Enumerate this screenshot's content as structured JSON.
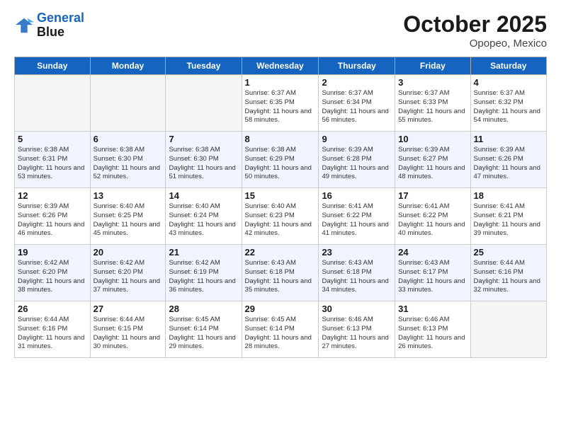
{
  "header": {
    "logo_line1": "General",
    "logo_line2": "Blue",
    "month": "October 2025",
    "location": "Opopeo, Mexico"
  },
  "weekdays": [
    "Sunday",
    "Monday",
    "Tuesday",
    "Wednesday",
    "Thursday",
    "Friday",
    "Saturday"
  ],
  "weeks": [
    [
      {
        "day": "",
        "info": ""
      },
      {
        "day": "",
        "info": ""
      },
      {
        "day": "",
        "info": ""
      },
      {
        "day": "1",
        "info": "Sunrise: 6:37 AM\nSunset: 6:35 PM\nDaylight: 11 hours\nand 58 minutes."
      },
      {
        "day": "2",
        "info": "Sunrise: 6:37 AM\nSunset: 6:34 PM\nDaylight: 11 hours\nand 56 minutes."
      },
      {
        "day": "3",
        "info": "Sunrise: 6:37 AM\nSunset: 6:33 PM\nDaylight: 11 hours\nand 55 minutes."
      },
      {
        "day": "4",
        "info": "Sunrise: 6:37 AM\nSunset: 6:32 PM\nDaylight: 11 hours\nand 54 minutes."
      }
    ],
    [
      {
        "day": "5",
        "info": "Sunrise: 6:38 AM\nSunset: 6:31 PM\nDaylight: 11 hours\nand 53 minutes."
      },
      {
        "day": "6",
        "info": "Sunrise: 6:38 AM\nSunset: 6:30 PM\nDaylight: 11 hours\nand 52 minutes."
      },
      {
        "day": "7",
        "info": "Sunrise: 6:38 AM\nSunset: 6:30 PM\nDaylight: 11 hours\nand 51 minutes."
      },
      {
        "day": "8",
        "info": "Sunrise: 6:38 AM\nSunset: 6:29 PM\nDaylight: 11 hours\nand 50 minutes."
      },
      {
        "day": "9",
        "info": "Sunrise: 6:39 AM\nSunset: 6:28 PM\nDaylight: 11 hours\nand 49 minutes."
      },
      {
        "day": "10",
        "info": "Sunrise: 6:39 AM\nSunset: 6:27 PM\nDaylight: 11 hours\nand 48 minutes."
      },
      {
        "day": "11",
        "info": "Sunrise: 6:39 AM\nSunset: 6:26 PM\nDaylight: 11 hours\nand 47 minutes."
      }
    ],
    [
      {
        "day": "12",
        "info": "Sunrise: 6:39 AM\nSunset: 6:26 PM\nDaylight: 11 hours\nand 46 minutes."
      },
      {
        "day": "13",
        "info": "Sunrise: 6:40 AM\nSunset: 6:25 PM\nDaylight: 11 hours\nand 45 minutes."
      },
      {
        "day": "14",
        "info": "Sunrise: 6:40 AM\nSunset: 6:24 PM\nDaylight: 11 hours\nand 43 minutes."
      },
      {
        "day": "15",
        "info": "Sunrise: 6:40 AM\nSunset: 6:23 PM\nDaylight: 11 hours\nand 42 minutes."
      },
      {
        "day": "16",
        "info": "Sunrise: 6:41 AM\nSunset: 6:22 PM\nDaylight: 11 hours\nand 41 minutes."
      },
      {
        "day": "17",
        "info": "Sunrise: 6:41 AM\nSunset: 6:22 PM\nDaylight: 11 hours\nand 40 minutes."
      },
      {
        "day": "18",
        "info": "Sunrise: 6:41 AM\nSunset: 6:21 PM\nDaylight: 11 hours\nand 39 minutes."
      }
    ],
    [
      {
        "day": "19",
        "info": "Sunrise: 6:42 AM\nSunset: 6:20 PM\nDaylight: 11 hours\nand 38 minutes."
      },
      {
        "day": "20",
        "info": "Sunrise: 6:42 AM\nSunset: 6:20 PM\nDaylight: 11 hours\nand 37 minutes."
      },
      {
        "day": "21",
        "info": "Sunrise: 6:42 AM\nSunset: 6:19 PM\nDaylight: 11 hours\nand 36 minutes."
      },
      {
        "day": "22",
        "info": "Sunrise: 6:43 AM\nSunset: 6:18 PM\nDaylight: 11 hours\nand 35 minutes."
      },
      {
        "day": "23",
        "info": "Sunrise: 6:43 AM\nSunset: 6:18 PM\nDaylight: 11 hours\nand 34 minutes."
      },
      {
        "day": "24",
        "info": "Sunrise: 6:43 AM\nSunset: 6:17 PM\nDaylight: 11 hours\nand 33 minutes."
      },
      {
        "day": "25",
        "info": "Sunrise: 6:44 AM\nSunset: 6:16 PM\nDaylight: 11 hours\nand 32 minutes."
      }
    ],
    [
      {
        "day": "26",
        "info": "Sunrise: 6:44 AM\nSunset: 6:16 PM\nDaylight: 11 hours\nand 31 minutes."
      },
      {
        "day": "27",
        "info": "Sunrise: 6:44 AM\nSunset: 6:15 PM\nDaylight: 11 hours\nand 30 minutes."
      },
      {
        "day": "28",
        "info": "Sunrise: 6:45 AM\nSunset: 6:14 PM\nDaylight: 11 hours\nand 29 minutes."
      },
      {
        "day": "29",
        "info": "Sunrise: 6:45 AM\nSunset: 6:14 PM\nDaylight: 11 hours\nand 28 minutes."
      },
      {
        "day": "30",
        "info": "Sunrise: 6:46 AM\nSunset: 6:13 PM\nDaylight: 11 hours\nand 27 minutes."
      },
      {
        "day": "31",
        "info": "Sunrise: 6:46 AM\nSunset: 6:13 PM\nDaylight: 11 hours\nand 26 minutes."
      },
      {
        "day": "",
        "info": ""
      }
    ]
  ]
}
